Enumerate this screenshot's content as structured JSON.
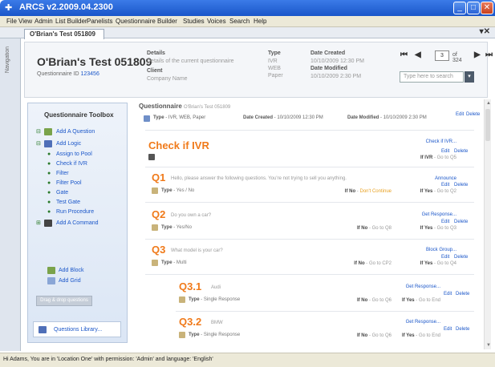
{
  "window": {
    "title": "ARCS  v2.2009.04.2300"
  },
  "menu": [
    "File",
    "View",
    "Admin",
    "List Builder",
    "Panelists",
    "Questionnaire Builder",
    "Studies",
    "Voices",
    "Search",
    "Help"
  ],
  "doc_tab": {
    "label": "O'Brian's Test 051809"
  },
  "side_nav_label": "Navigation",
  "header": {
    "title": "O'Brian's Test 051809",
    "qid_label": "Questionnaire ID",
    "qid_value": "123456",
    "details_label": "Details",
    "details_value": "Details of the current questionnaire",
    "client_label": "Client",
    "client_value": "Company Name",
    "type_label": "Type",
    "type_values": [
      "IVR",
      "WEB",
      "Paper"
    ],
    "date_created_label": "Date Created",
    "date_created_value": "10/10/2009 12:30 PM",
    "date_modified_label": "Date Modified",
    "date_modified_value": "10/10/2009 2:30 PM",
    "pager": {
      "current": "3",
      "of_text": "of 324"
    },
    "search_placeholder": "Type here to search",
    "colors": {
      "accent_orange": "#f07a1a",
      "link_blue": "#1a56c9"
    }
  },
  "toolbox": {
    "title": "Questionnaire Toolbox",
    "add_question": "Add A Question",
    "add_logic": "Add Logic",
    "logic_items": [
      "Assign to Pool",
      "Check if IVR",
      "Filter",
      "Filter Pool",
      "Gate",
      "Test Gate",
      "Run Procedure"
    ],
    "add_command": "Add A Command",
    "add_block": "Add Block",
    "add_grid": "Add Grid",
    "drag_button": "Drag & drop questions",
    "library": "Questions Library..."
  },
  "main": {
    "section_title": "Questionnaire",
    "section_sub": "O'Brian's Test 051809",
    "type_label": "Type",
    "type_value": "IVR, WEB, Paper",
    "date_created_label": "Date Created",
    "date_created_value": "10/10/2009 12:30 PM",
    "date_modified_label": "Date Modified",
    "date_modified_value": "10/10/2009 2:30 PM",
    "edit": "Edit",
    "delete": "Delete",
    "check_title": "Check if IVR",
    "check_action": "Check if IVR...",
    "check_logic_key": "If IVR",
    "check_logic_val": "Go to Q5",
    "q1": {
      "label": "Q1",
      "text": "Hello, please answer the following questions. You're not trying to sell you anything.",
      "type_label": "Type",
      "type_value": "Yes / No",
      "action": "Announce",
      "logic_no_key": "If No",
      "logic_no_val": "Don't Continue",
      "logic_yes_key": "If Yes",
      "logic_yes_val": "Go to Q2"
    },
    "q2": {
      "label": "Q2",
      "text": "Do you own a car?",
      "type_label": "Type",
      "type_value": "Yes/No",
      "action": "Get Response...",
      "logic_no_key": "If No",
      "logic_no_val": "Go to Q8",
      "logic_yes_key": "If Yes",
      "logic_yes_val": "Go to Q3"
    },
    "q3": {
      "label": "Q3",
      "text": "What model is your car?",
      "type_label": "Type",
      "type_value": "Multi",
      "action": "Block Group...",
      "logic_no_key": "If No",
      "logic_no_val": "Go to CP2",
      "logic_yes_key": "If Yes",
      "logic_yes_val": "Go to Q4"
    },
    "q31": {
      "label": "Q3.1",
      "text": "Audi",
      "type_label": "Type",
      "type_value": "Single Response",
      "action": "Get Response...",
      "logic_no_key": "If No",
      "logic_no_val": "Go to Q6",
      "logic_yes_key": "If Yes",
      "logic_yes_val": "Go to End"
    },
    "q32": {
      "label": "Q3.2",
      "text": "BMW",
      "type_label": "Type",
      "type_value": "Single Response",
      "action": "Get Response...",
      "logic_no_key": "If No",
      "logic_no_val": "Go to Q6",
      "logic_yes_key": "If Yes",
      "logic_yes_val": "Go to End"
    }
  },
  "status": "Hi Adams, You are in 'Location One' with permission: 'Admin' and language: 'English'"
}
